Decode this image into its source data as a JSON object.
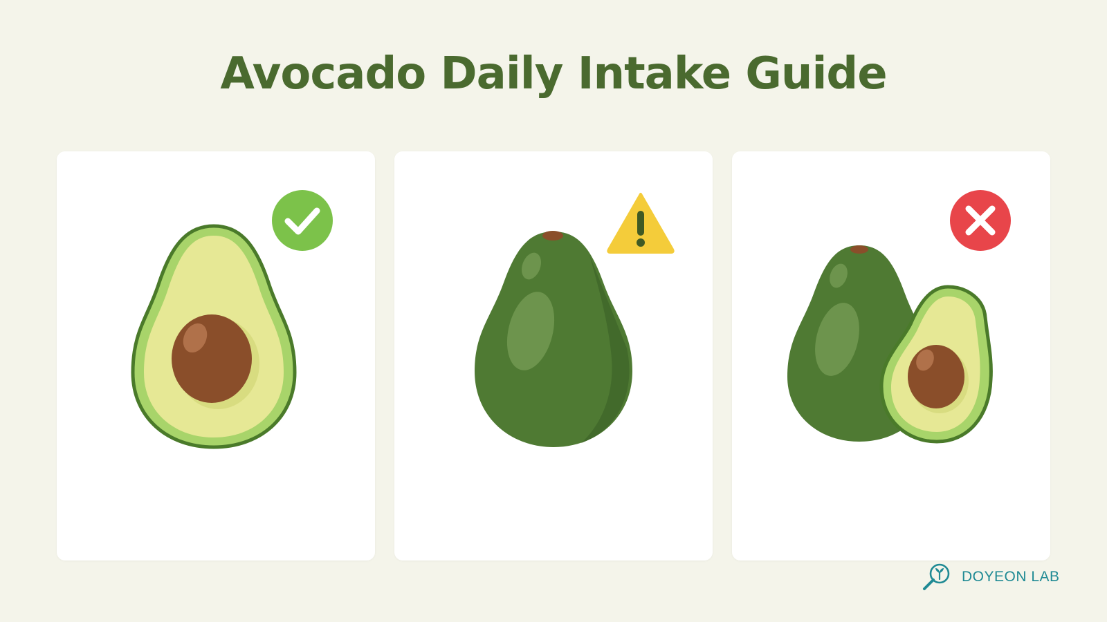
{
  "title": "Avocado Daily Intake Guide",
  "colors": {
    "background": "#f4f4ea",
    "title": "#4a6a2f",
    "recommended": "#7cc24a",
    "caution": "#f4cc3a",
    "avoid": "#e8454a",
    "brand": "#1f8a94"
  },
  "cards": [
    {
      "illustration": "avocado-half-with-pit",
      "status_icon": "check-circle-icon"
    },
    {
      "illustration": "whole-avocado",
      "status_icon": "warning-triangle-icon"
    },
    {
      "illustration": "whole-avocado-and-half-avocado",
      "status_icon": "cross-circle-icon"
    }
  ],
  "brand": {
    "name": "DOYEON LAB",
    "logo_icon": "magnifier-sprout-icon"
  }
}
